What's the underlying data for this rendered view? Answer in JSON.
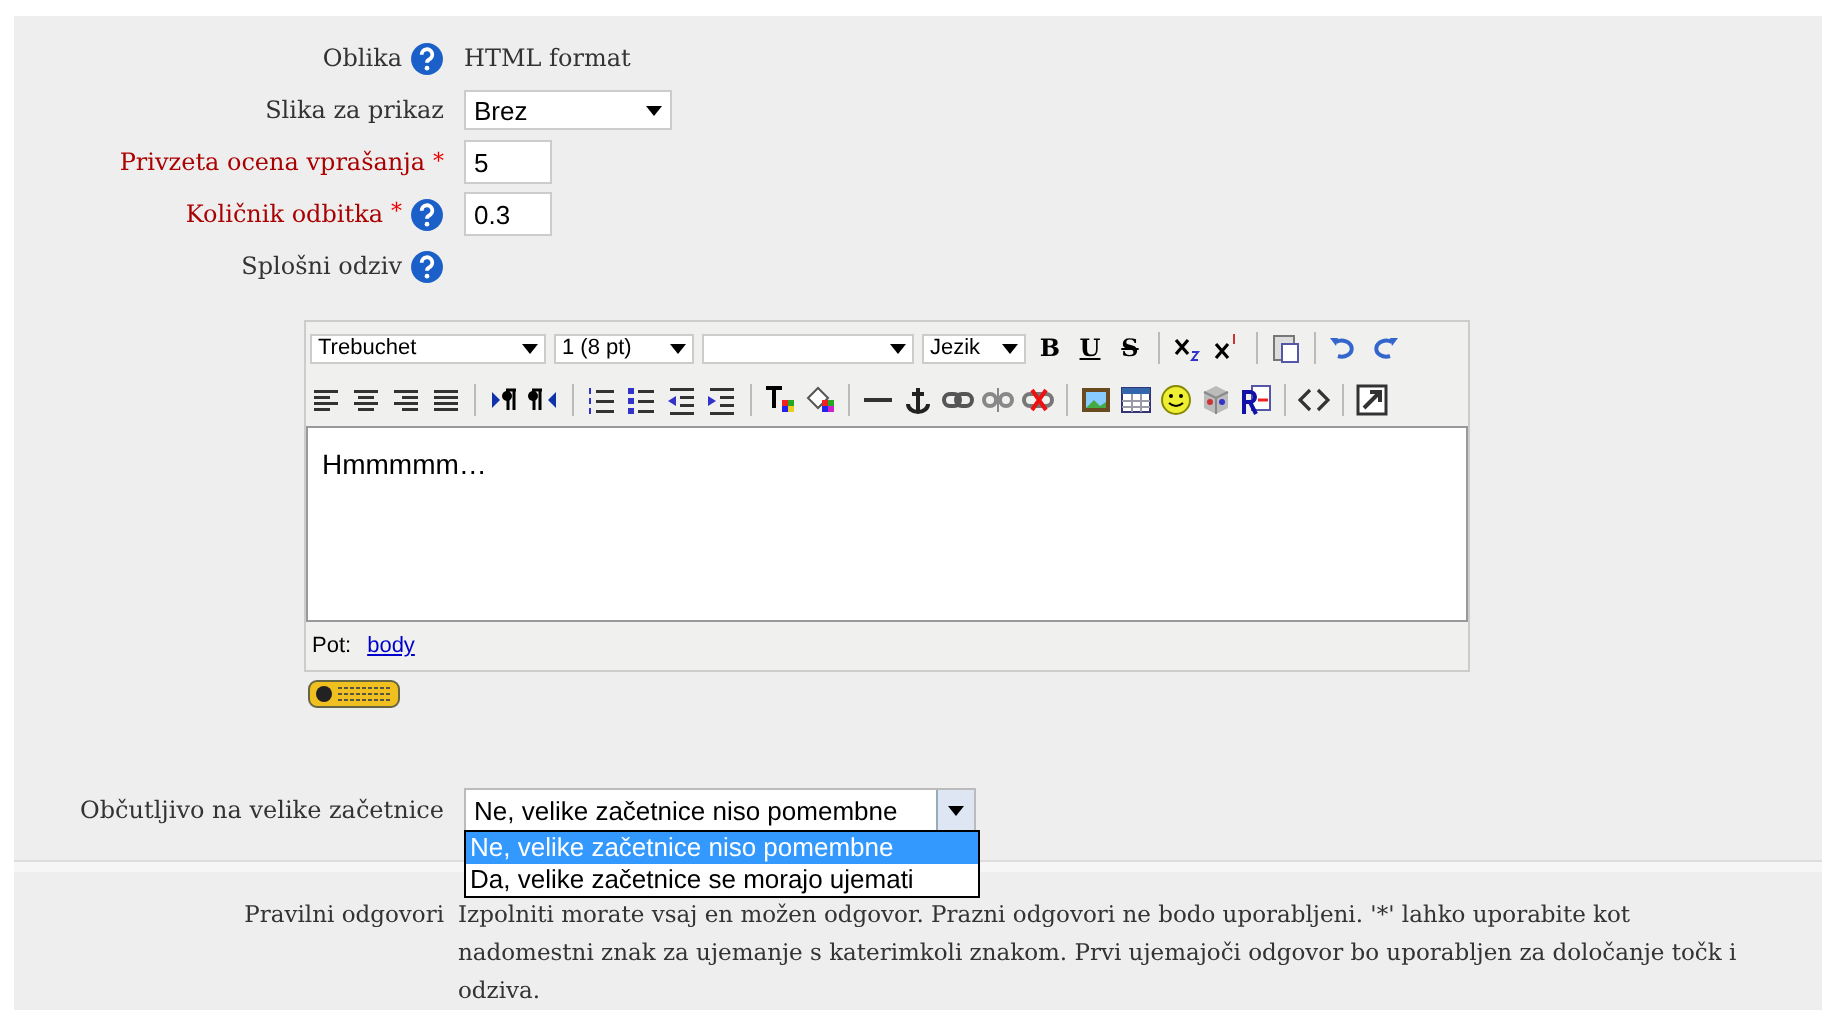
{
  "required_mark": "*",
  "fields": [
    {
      "label": "Oblika",
      "required": false,
      "help": true,
      "kind": "text",
      "value": "HTML format"
    },
    {
      "label": "Slika za prikaz",
      "required": false,
      "help": false,
      "kind": "select",
      "value": "Brez"
    },
    {
      "label": "Privzeta ocena vprašanja",
      "required": true,
      "help": false,
      "kind": "input",
      "value": "5"
    },
    {
      "label": "Količnik odbitka",
      "required": true,
      "help": true,
      "kind": "input",
      "value": "0.3"
    },
    {
      "label": "Splošni odziv",
      "required": false,
      "help": true,
      "kind": "editor"
    }
  ],
  "editor": {
    "font": "Trebuchet",
    "size": "1 (8 pt)",
    "language": "Jezik",
    "format_buttons": [
      "B",
      "U",
      "S"
    ],
    "content": "Hmmmmm…",
    "path_label": "Pot:",
    "path_link": "body"
  },
  "case_sensitivity": {
    "label": "Občutljivo na velike začetnice",
    "value": "Ne, velike začetnice niso pomembne",
    "open": true,
    "options": [
      {
        "label": "Ne, velike začetnice niso pomembne",
        "selected": true
      },
      {
        "label": "Da, velike začetnice se morajo ujemati",
        "selected": false
      }
    ]
  },
  "answers": {
    "label": "Pravilni odgovori",
    "lines": [
      "Izpolniti morate vsaj en možen odgovor. Prazni odgovori ne bodo uporabljeni. '*' lahko uporabite kot",
      "nadomestni znak za ujemanje s katerimkoli znakom. Prvi ujemajoči odgovor bo uporabljen za določanje točk i",
      "odziva."
    ]
  }
}
